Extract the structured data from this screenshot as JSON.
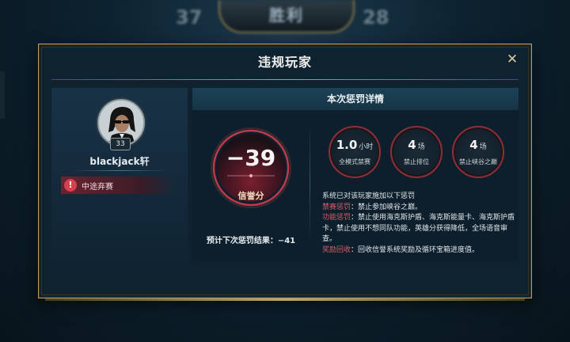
{
  "background": {
    "score_left": "37",
    "score_right": "28",
    "victory_text": "胜利"
  },
  "dialog": {
    "title": "违规玩家",
    "close_icon": "close-icon"
  },
  "player": {
    "name": "blackjack轩",
    "level": "33",
    "violation_tag": "中途弃赛",
    "tag_icon": "exclamation-icon"
  },
  "penalty": {
    "header": "本次惩罚详情",
    "credit_change": "−39",
    "credit_label": "信誉分",
    "next_result": "预计下次惩罚结果：−41",
    "stats": [
      {
        "value": "1.0",
        "unit": "小时",
        "label": "全模式禁赛"
      },
      {
        "value": "4",
        "unit": "场",
        "label": "禁止排位"
      },
      {
        "value": "4",
        "unit": "场",
        "label": "禁止峡谷之巅"
      }
    ],
    "description_intro": "系统已对该玩家施加以下惩罚",
    "ban_key": "禁赛惩罚",
    "ban_text": "：禁止参加峡谷之巅。",
    "func_key": "功能惩罚",
    "func_text": "：禁止使用海克斯护盾、海克斯能量卡、海克斯护盾卡，禁止使用不想同队功能，英雄分获得降低，全场语音审查。",
    "reward_key": "奖励回收",
    "reward_text": "：回收信誉系统奖励及循环宝箱进度值。"
  },
  "colors": {
    "accent_gold": "#b89b5e",
    "penalty_red": "#d8404e"
  }
}
